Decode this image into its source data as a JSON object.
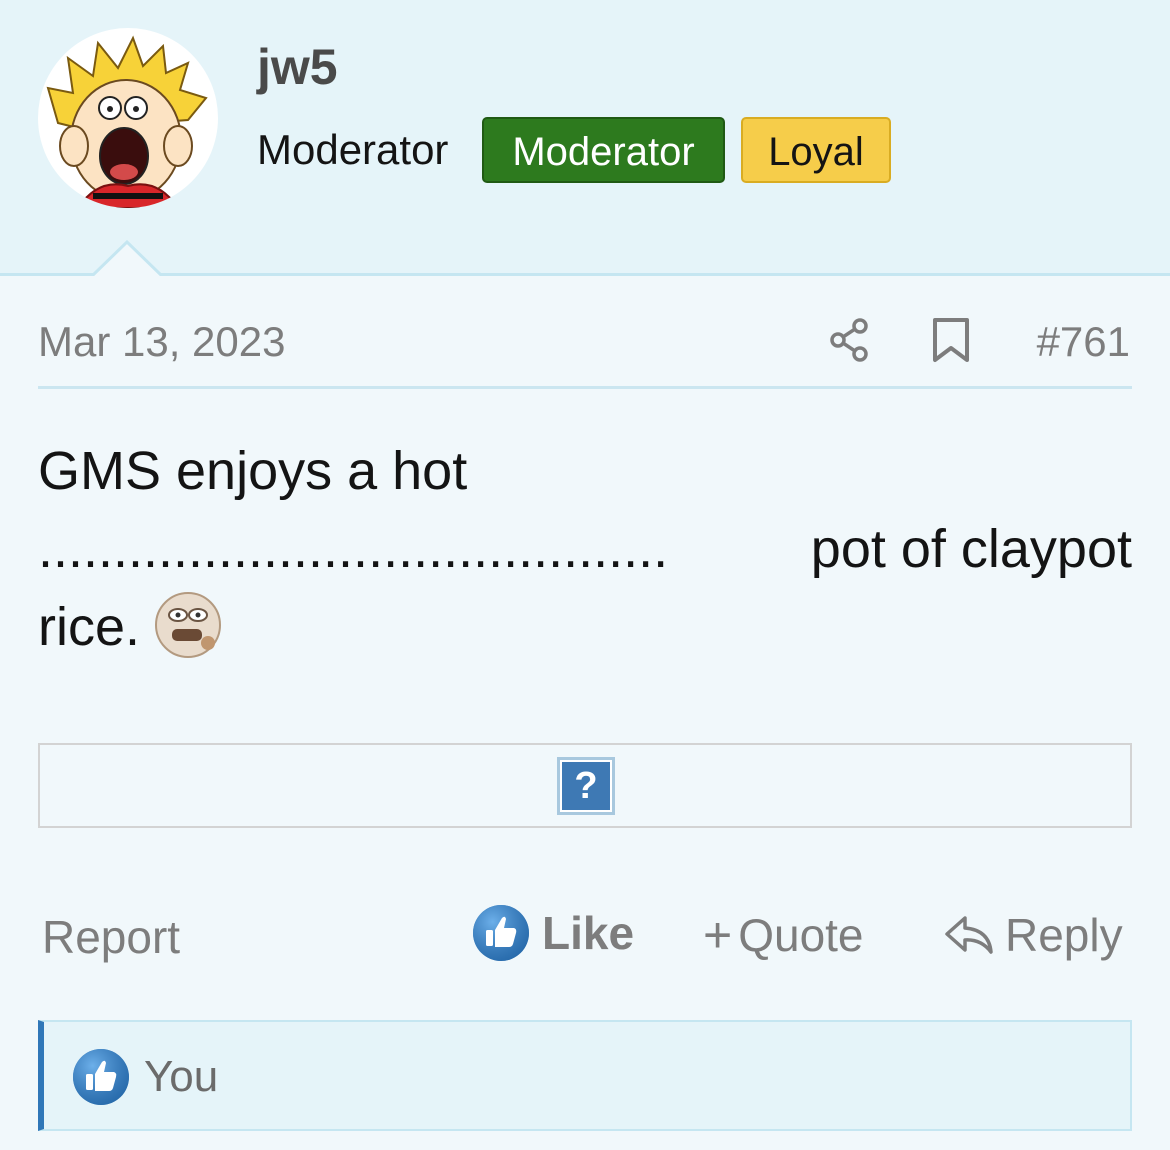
{
  "user": {
    "username": "jw5",
    "title": "Moderator",
    "badges": [
      {
        "label": "Moderator",
        "color": "#2d7a1e"
      },
      {
        "label": "Loyal",
        "color": "#f6cd4a"
      }
    ]
  },
  "post": {
    "date": "Mar 13, 2023",
    "number": "#761",
    "body_line1": "GMS enjoys a hot",
    "body_dots": "..........................................",
    "body_line2_end": "pot of claypot",
    "body_line3": "rice.",
    "smiley_icon": "shocked-smiley-icon",
    "broken_image_glyph": "?"
  },
  "actions": {
    "report": "Report",
    "like": "Like",
    "quote_plus": "+",
    "quote": "Quote",
    "reply": "Reply"
  },
  "likes": {
    "text": "You"
  },
  "colors": {
    "header_bg": "#e5f4f9",
    "page_bg": "#f1f8fb",
    "like_blue": "#2f77b8"
  }
}
